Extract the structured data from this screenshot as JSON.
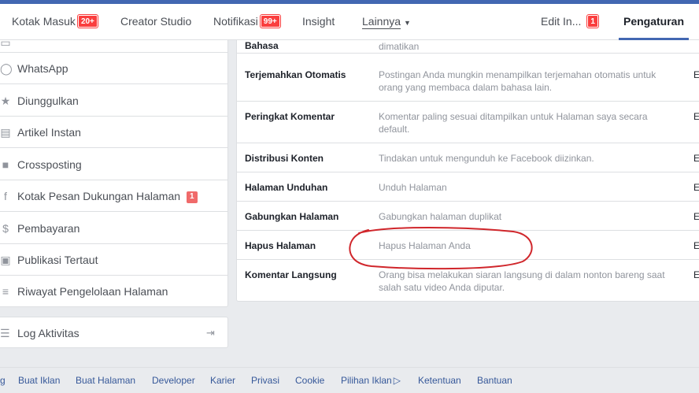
{
  "nav": {
    "inbox": {
      "label": "Kotak Masuk",
      "badge": "20+"
    },
    "creator_studio": "Creator Studio",
    "notifications": {
      "label": "Notifikasi",
      "badge": "99+"
    },
    "insight": "Insight",
    "more": "Lainnya",
    "edit_info": {
      "label": "Edit In...",
      "badge": "1"
    },
    "settings": "Pengaturan"
  },
  "sidebar": {
    "items": [
      {
        "label": "WhatsApp",
        "icon": "whatsapp-icon"
      },
      {
        "label": "Diunggulkan",
        "icon": "star-icon"
      },
      {
        "label": "Artikel Instan",
        "icon": "article-icon"
      },
      {
        "label": "Crossposting",
        "icon": "video-camera-icon"
      },
      {
        "label": "Kotak Pesan Dukungan Halaman",
        "icon": "facebook-icon",
        "badge": "1"
      },
      {
        "label": "Pembayaran",
        "icon": "dollar-icon"
      },
      {
        "label": "Publikasi Tertaut",
        "icon": "linked-publication-icon"
      },
      {
        "label": "Riwayat Pengelolaan Halaman",
        "icon": "history-settings-icon"
      }
    ],
    "activity_log": "Log Aktivitas"
  },
  "settings_rows": [
    {
      "label": "Bahasa",
      "description": "dimatikan",
      "edit": "E"
    },
    {
      "label": "Terjemahkan Otomatis",
      "description": "Postingan Anda mungkin menampilkan terjemahan otomatis untuk orang yang membaca dalam bahasa lain.",
      "edit": "E"
    },
    {
      "label": "Peringkat Komentar",
      "description": "Komentar paling sesuai ditampilkan untuk Halaman saya secara default.",
      "edit": "E"
    },
    {
      "label": "Distribusi Konten",
      "description": "Tindakan untuk mengunduh ke Facebook diizinkan.",
      "edit": "E"
    },
    {
      "label": "Halaman Unduhan",
      "description": "Unduh Halaman",
      "edit": "E"
    },
    {
      "label": "Gabungkan Halaman",
      "description": "Gabungkan halaman duplikat",
      "edit": "E"
    },
    {
      "label": "Hapus Halaman",
      "description": "Hapus Halaman Anda",
      "edit": "E"
    },
    {
      "label": "Komentar Langsung",
      "description": "Orang bisa melakukan siaran langsung di dalam nonton bareng saat salah satu video Anda diputar.",
      "edit": "E"
    }
  ],
  "footer": {
    "links": [
      "Buat Iklan",
      "Buat Halaman",
      "Developer",
      "Karier",
      "Privasi",
      "Cookie",
      "Pilihan Iklan",
      "Ketentuan",
      "Bantuan"
    ]
  },
  "colors": {
    "brand": "#4267b2",
    "badge": "#fa3e3e",
    "annotation": "#d0262b"
  }
}
